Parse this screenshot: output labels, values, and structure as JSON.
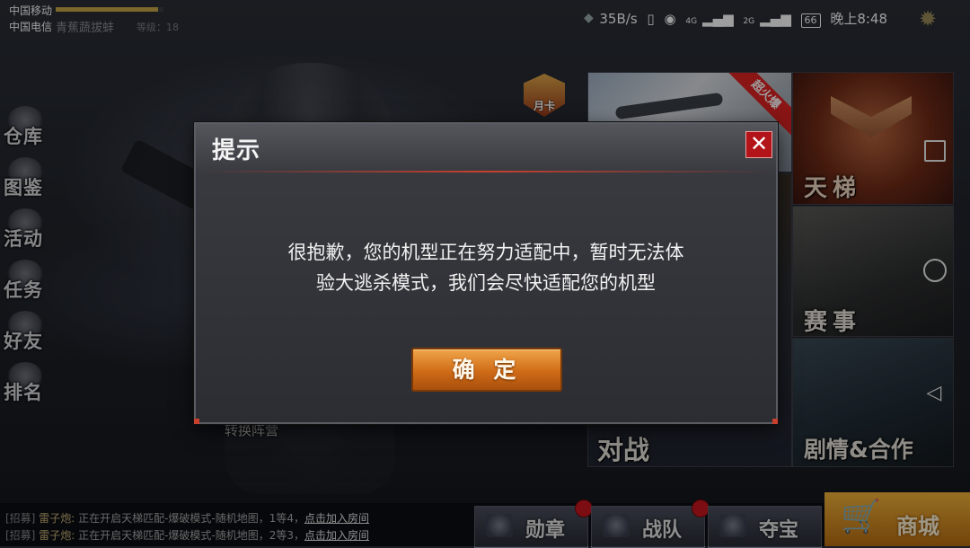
{
  "status_bar": {
    "carrier_1": "中国移动",
    "carrier_2": "中国电信",
    "speed": "35B/s",
    "network_1": "4G",
    "network_2": "2G",
    "battery": "66",
    "time": "晚上8:48"
  },
  "player": {
    "name": "青蕉蔬拔蚌",
    "level": "等级：18",
    "xp_fraction": 0.95
  },
  "left_menu": [
    {
      "label": "仓库",
      "icon": "warehouse-icon"
    },
    {
      "label": "图鉴",
      "icon": "catalog-icon"
    },
    {
      "label": "活动",
      "icon": "activity-icon"
    },
    {
      "label": "任务",
      "icon": "task-icon"
    },
    {
      "label": "好友",
      "icon": "friends-icon"
    },
    {
      "label": "排名",
      "icon": "ranking-icon"
    }
  ],
  "month_card": {
    "label": "月卡"
  },
  "modes": {
    "event_badge": "超火爆",
    "ladder": "天梯",
    "match": "赛事",
    "battle": "对战",
    "story": "剧情&合作"
  },
  "switch_camp": "转换阵营",
  "chat": [
    {
      "tag": "[招募]",
      "who": "雷子炮:",
      "msg": "正在开启天梯匹配-爆破模式-随机地图，1等4，",
      "link": "点击加入房间"
    },
    {
      "tag": "[招募]",
      "who": "雷子炮:",
      "msg": "正在开启天梯匹配-爆破模式-随机地图，2等3，",
      "link": "点击加入房间"
    }
  ],
  "bottom_buttons": {
    "medal": "勋章",
    "team": "战队",
    "treasure": "夺宝",
    "shop": "商城"
  },
  "dialog": {
    "title": "提示",
    "message_line1": "很抱歉，您的机型正在努力适配中，暂时无法体",
    "message_line2": "验大逃杀模式，我们会尽快适配您的机型",
    "confirm": "确 定"
  },
  "colors": {
    "accent": "#cf6b17",
    "close": "#b3141a",
    "notify_dot": "#c8161d"
  }
}
